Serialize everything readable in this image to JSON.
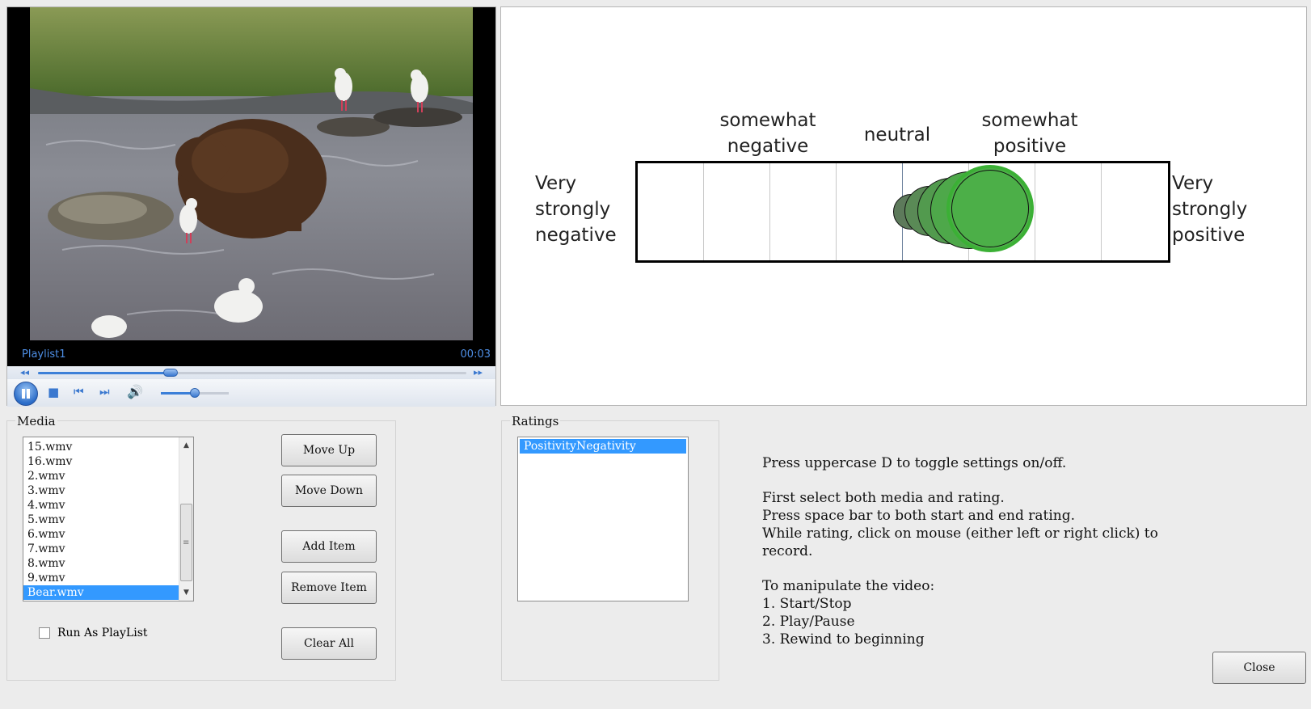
{
  "player": {
    "playlist_name": "Playlist1",
    "time": "00:03",
    "seek_fraction": 0.31,
    "volume_fraction": 0.5
  },
  "scale": {
    "labels": {
      "very_strongly_negative": [
        "Very",
        "strongly",
        "negative"
      ],
      "somewhat_negative": [
        "somewhat",
        "negative"
      ],
      "neutral": "neutral",
      "somewhat_positive": [
        "somewhat",
        "positive"
      ],
      "very_strongly_positive": [
        "Very",
        "strongly",
        "positive"
      ]
    },
    "segments": 8,
    "trail_color": "#4caf48",
    "trail_dark_color": "#5a7a58"
  },
  "media": {
    "title": "Media",
    "items": [
      "15.wmv",
      "16.wmv",
      "2.wmv",
      "3.wmv",
      "4.wmv",
      "5.wmv",
      "6.wmv",
      "7.wmv",
      "8.wmv",
      "9.wmv",
      "Bear.wmv"
    ],
    "selected_index": 10,
    "buttons": {
      "move_up": "Move Up",
      "move_down": "Move Down",
      "add_item": "Add Item",
      "remove_item": "Remove Item",
      "clear_all": "Clear All"
    },
    "run_as_playlist_label": "Run As PlayList",
    "run_as_playlist_checked": false
  },
  "ratings": {
    "title": "Ratings",
    "items": [
      "PositivityNegativity"
    ],
    "selected_index": 0
  },
  "help": {
    "line1": "Press uppercase D to toggle settings on/off.",
    "line2": "First select both media and rating.",
    "line3": "Press space bar to both start and end rating.",
    "line4": "While rating, click on mouse (either left or right click) to record.",
    "line5": "To manipulate the video:",
    "line6": "1. Start/Stop",
    "line7": "2. Play/Pause",
    "line8": "3. Rewind to beginning"
  },
  "close_label": "Close"
}
